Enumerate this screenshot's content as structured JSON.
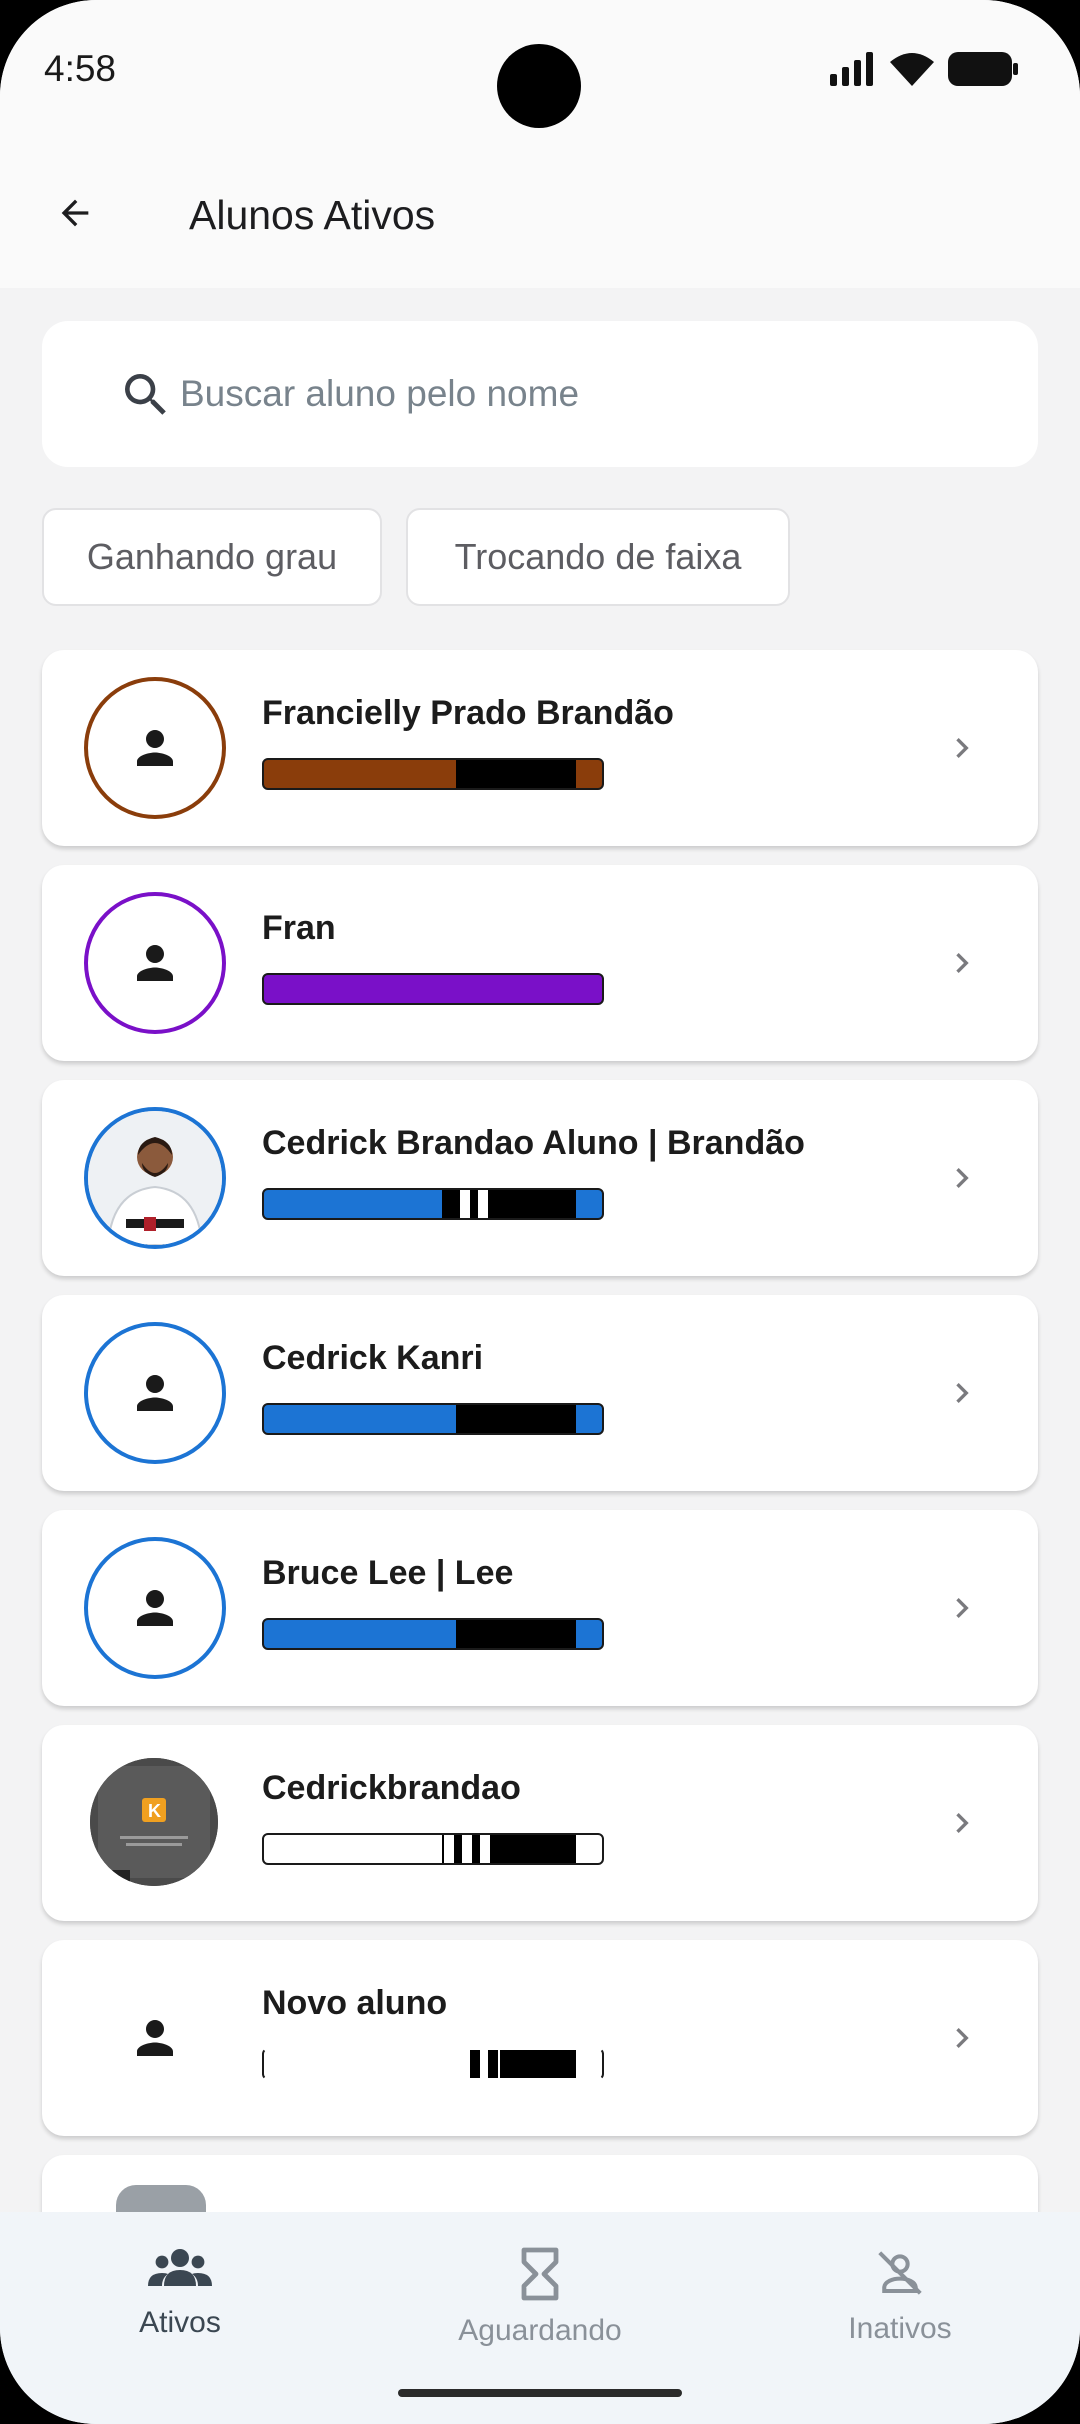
{
  "status_bar": {
    "time": "4:58"
  },
  "app_bar": {
    "title": "Alunos Ativos"
  },
  "search": {
    "placeholder": "Buscar aluno pelo nome"
  },
  "filters": [
    {
      "label": "Ganhando grau"
    },
    {
      "label": "Trocando de faixa"
    }
  ],
  "students": [
    {
      "name": "Francielly Prado Brandão",
      "belt_color": "#8a3d0b",
      "ring_color": "#8a3d0b",
      "stripes": 0,
      "avatar": "person-icon"
    },
    {
      "name": "Fran",
      "belt_color": "#7a10c8",
      "ring_color": "#7a10c8",
      "stripes": 0,
      "avatar": "person-icon"
    },
    {
      "name": "Cedrick Brandao Aluno | Brandão",
      "belt_color": "#1c74d4",
      "ring_color": "#1c74d4",
      "stripes": 2,
      "avatar": "photo"
    },
    {
      "name": "Cedrick Kanri",
      "belt_color": "#1c74d4",
      "ring_color": "#1c74d4",
      "stripes": 0,
      "avatar": "person-icon"
    },
    {
      "name": "Bruce Lee | Lee",
      "belt_color": "#1c74d4",
      "ring_color": "#1c74d4",
      "stripes": 0,
      "avatar": "person-icon"
    },
    {
      "name": "Cedrickbrandao",
      "belt_color": "#ffffff",
      "ring_color": "none",
      "stripes": 3,
      "avatar": "photo-kanri"
    },
    {
      "name": "Novo aluno",
      "belt_color": "#ffffff",
      "ring_color": "none",
      "stripes": 2,
      "avatar": "person-icon"
    }
  ],
  "bottom_nav": {
    "items": [
      {
        "label": "Ativos",
        "icon": "groups-icon",
        "active": true
      },
      {
        "label": "Aguardando",
        "icon": "hourglass-icon",
        "active": false
      },
      {
        "label": "Inativos",
        "icon": "person-off-icon",
        "active": false
      }
    ]
  },
  "colors": {
    "active_nav": "#3b4752",
    "inactive_nav": "#8a9199",
    "background": "#f3f3f4"
  }
}
